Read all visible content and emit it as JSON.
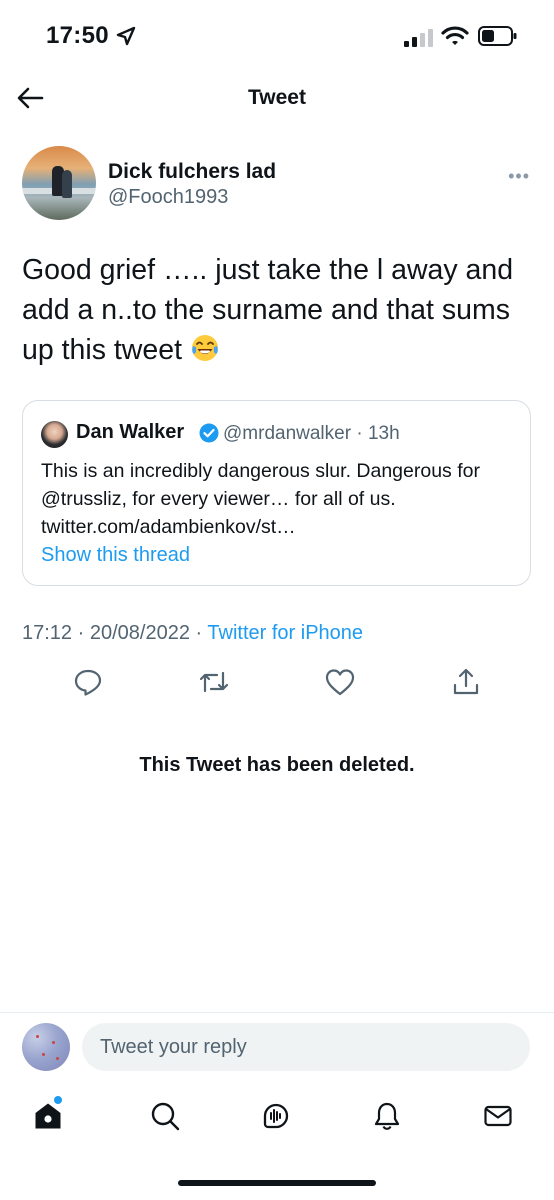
{
  "status_bar": {
    "time": "17:50",
    "icons": [
      "location-arrow-icon",
      "cellular-signal-icon",
      "wifi-icon",
      "battery-icon"
    ]
  },
  "header": {
    "title": "Tweet",
    "back_icon": "back-arrow-icon"
  },
  "tweet": {
    "author_name": "Dick fulchers lad",
    "author_handle": "@Fooch1993",
    "text": "Good grief ….. just take the l away and add a n..to the surname and that sums up this tweet",
    "emoji": "face-with-tears-of-joy-emoji",
    "time": "17:12",
    "date": "20/08/2022",
    "source": "Twitter for iPhone",
    "separator": "·"
  },
  "quote": {
    "author_name": "Dan Walker",
    "verified": true,
    "author_handle": "@mrdanwalker",
    "age": "13h",
    "text": "This is an incredibly dangerous slur. Dangerous for @trussliz, for every viewer… for all of us. twitter.com/adambienkov/st…",
    "show_thread": "Show this thread"
  },
  "actions": [
    "reply-icon",
    "retweet-icon",
    "like-icon",
    "share-icon"
  ],
  "deleted_notice": "This Tweet has been deleted.",
  "reply": {
    "placeholder": "Tweet your reply"
  },
  "tab_bar": {
    "tabs": [
      "home-icon",
      "search-icon",
      "spaces-icon",
      "notifications-icon",
      "messages-icon"
    ],
    "home_has_new": true
  },
  "colors": {
    "accent": "#1d9bf0",
    "text_primary": "#0f1419",
    "text_secondary": "#536471",
    "border": "#d8dee3"
  }
}
